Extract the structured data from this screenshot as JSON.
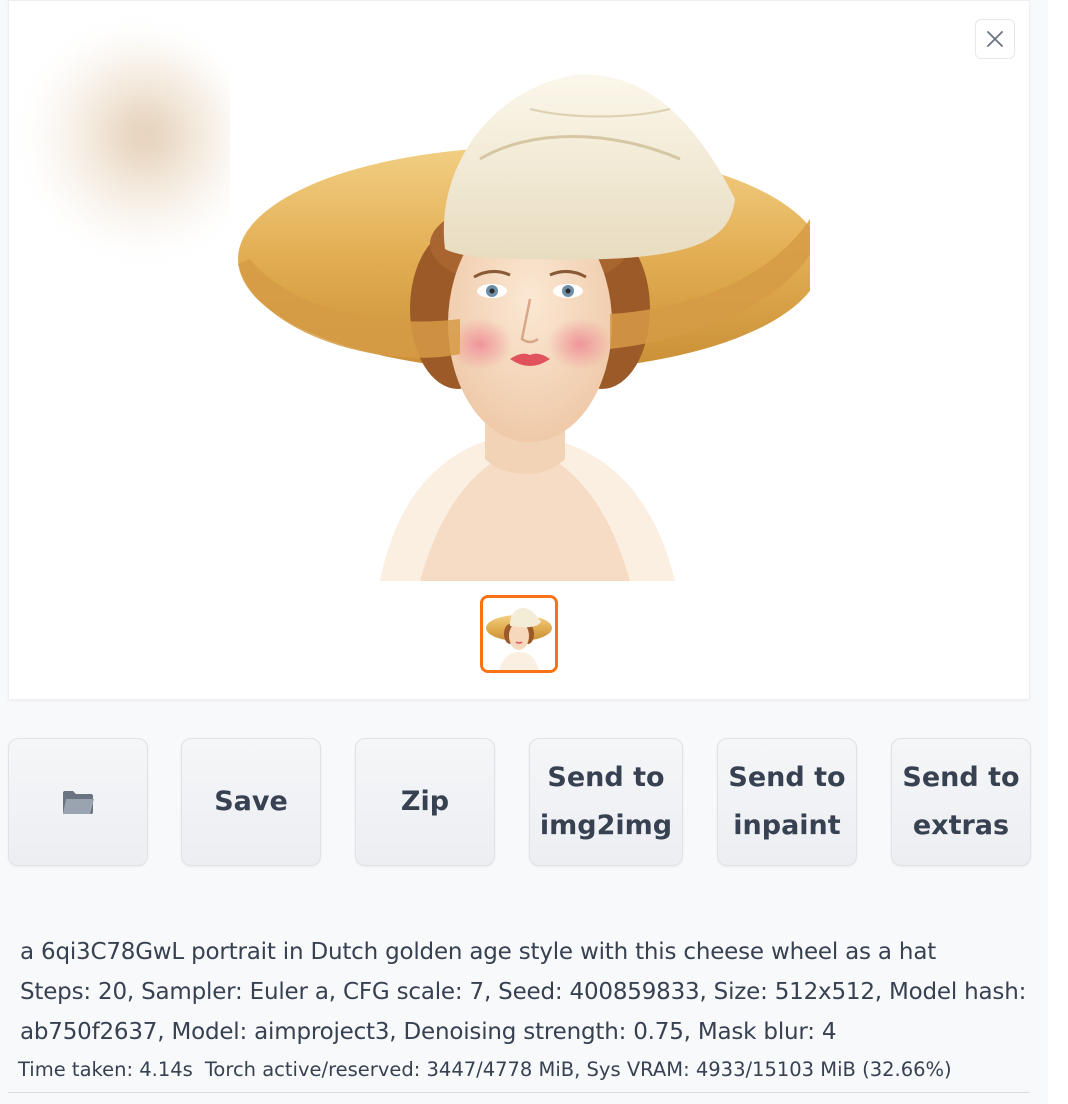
{
  "gallery": {
    "close_label": "×",
    "image_desc": "portrait",
    "thumbnail_count": 1,
    "selected_thumbnail": 1
  },
  "actions": {
    "folder_icon": "folder-icon",
    "save_label": "Save",
    "zip_label": "Zip",
    "send_img2img_label": "Send to\nimg2img",
    "send_inpaint_label": "Send to\ninpaint",
    "send_extras_label": "Send to\nextras"
  },
  "generation_info": {
    "prompt": "a 6qi3C78GwL portrait in Dutch golden age style with this cheese wheel as a hat",
    "params": "Steps: 20, Sampler: Euler a, CFG scale: 7, Seed: 400859833, Size: 512x512, Model hash: ab750f2637, Model: aimproject3, Denoising strength: 0.75, Mask blur: 4",
    "time_taken": "Time taken: 4.14s",
    "memory": "Torch active/reserved: 3447/4778 MiB, Sys VRAM: 4933/15103 MiB (32.66%)"
  },
  "colors": {
    "accent": "#f97316",
    "text": "#374151",
    "hat_brim": "#e8b85a",
    "hat_crown": "#f3ecd7"
  }
}
